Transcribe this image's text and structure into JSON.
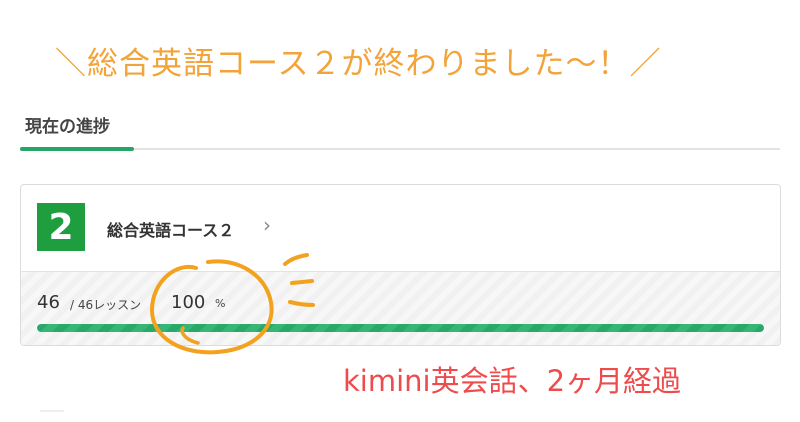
{
  "headline": {
    "prefix": "＼",
    "text": "総合英語コース２が終わりました〜！",
    "suffix": "／"
  },
  "section": {
    "title": "現在の進捗"
  },
  "course": {
    "number": "2",
    "name": "総合英語コース２",
    "chevron_icon": "chevron-right-icon",
    "lessons_done": "46",
    "lessons_total_label": "/ 46レッスン",
    "percent_value": "100",
    "percent_sign": "%",
    "progress_fraction": 1.0
  },
  "caption": {
    "text": "kimini英会話、2ヶ月経過"
  },
  "colors": {
    "headline": "#f2a43b",
    "badge": "#1e9e3e",
    "progress": "#2aa86a",
    "caption": "#ee4c4c",
    "doodle": "#f2a21e"
  }
}
